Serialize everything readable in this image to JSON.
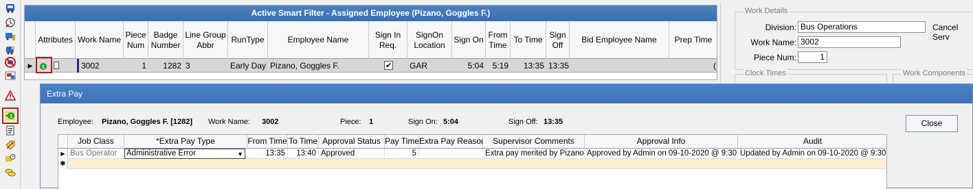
{
  "toolbar": {
    "icons": [
      "bus-icon",
      "clock-edit-icon",
      "bus-chart-icon",
      "bus-person-icon",
      "no-bus-icon",
      "bus-grid-icon",
      "warning-icon",
      "extra-pay-icon",
      "clipboard-icon",
      "tag-icon",
      "bus-clock-icon",
      "coins-icon"
    ],
    "selected": "extra-pay-icon"
  },
  "main_grid": {
    "title": "Active Smart Filter - Assigned Employee (Pizano, Goggles F.)",
    "columns": [
      "Attributes",
      "Work Name",
      "Piece\nNum",
      "Badge\nNumber",
      "Line Group\nAbbr",
      "RunType",
      "Employee Name",
      "Sign In\nReq.",
      "SignOn\nLocation",
      "Sign On",
      "From\nTime",
      "To Time",
      "Sign\nOff",
      "Bid Employee Name",
      "Prep Time"
    ],
    "row": {
      "work_name": "3002",
      "piece_num": "1",
      "badge_number": "1282",
      "line_group": "3",
      "run_type": "Early Day",
      "employee_name": "Pizano, Goggles F.",
      "sign_in_req": "✔",
      "signon_location": "GAR",
      "sign_on": "5:04",
      "from_time": "5:19",
      "to_time": "13:35",
      "sign_off": "13:35",
      "bid_employee_name": "",
      "prep_time": "("
    }
  },
  "work_details": {
    "legend": "Work Details",
    "division_label": "Division:",
    "division_value": "Bus Operations",
    "cancel_label": "Cancel Serv",
    "work_name_label": "Work Name:",
    "work_name_value": "3002",
    "piece_num_label": "Piece Num:",
    "piece_num_value": "1",
    "clock_times_legend": "Clock Times",
    "work_components_legend": "Work Components"
  },
  "dialog": {
    "title": "Extra Pay",
    "employee_label": "Employee:",
    "employee_value": "Pizano, Goggles F. [1282]",
    "work_name_label": "Work Name:",
    "work_name_value": "3002",
    "piece_label": "Piece:",
    "piece_value": "1",
    "sign_on_label": "Sign On:",
    "sign_on_value": "5:04",
    "sign_off_label": "Sign Off:",
    "sign_off_value": "13:35",
    "close_label": "Close",
    "grid": {
      "columns": [
        "Job Class",
        "*Extra Pay Type",
        "From Time",
        "To Time",
        "Approval Status",
        "Pay Time",
        "Extra Pay Reason",
        "Supervisor Comments",
        "Approval Info",
        "Audit"
      ],
      "row": {
        "job_class": "Bus Operator",
        "extra_pay_type": "Administrative Error",
        "from_time": "13:35",
        "to_time": "13:40",
        "approval_status": "Approved",
        "pay_time": "5",
        "extra_pay_reason": "",
        "supervisor_comments": "Extra pay merited by Pizano.",
        "approval_info": "Approved by Admin on 09-10-2020 @  9:30",
        "audit": "Updated by Admin on 09-10-2020 @  9:30"
      },
      "row_indicator": "▶",
      "new_row_indicator": "✱"
    }
  }
}
